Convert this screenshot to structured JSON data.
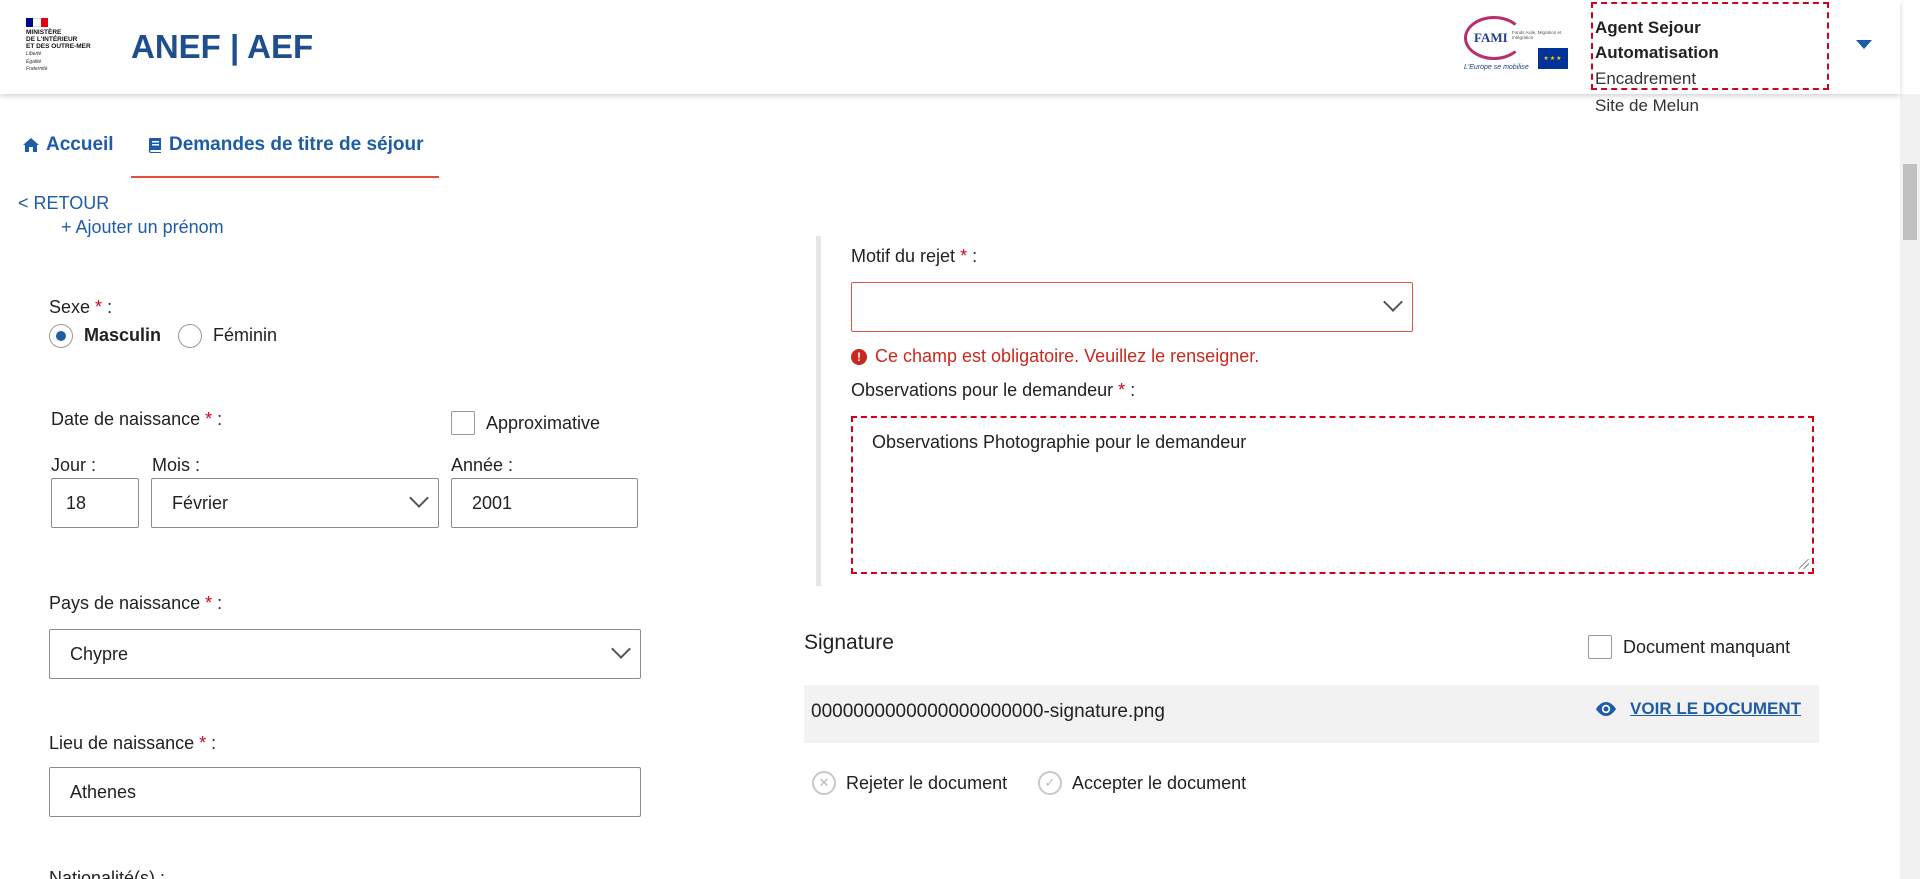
{
  "header": {
    "ministry": [
      "Ministère",
      "de l'intérieur",
      "et des outre-mer"
    ],
    "devise": [
      "Liberté",
      "Égalité",
      "Fraternité"
    ],
    "app_title": "ANEF | AEF",
    "fami": {
      "word": "FAMI",
      "subtitle": "Fonds Asile, Migration et Intégration",
      "slogan": "L'Europe se mobilise"
    },
    "user": {
      "name": "Agent Sejour Automatisation",
      "role": "Encadrement",
      "site": "Site de Melun"
    }
  },
  "nav": {
    "accueil": "Accueil",
    "demandes": "Demandes de titre de séjour",
    "retour": "< RETOUR"
  },
  "form": {
    "add_prenom": "+ Ajouter un prénom",
    "sexe": {
      "label": "Sexe",
      "options": [
        "Masculin",
        "Féminin"
      ],
      "selected": "Masculin"
    },
    "date_naissance": {
      "label": "Date de naissance",
      "approx_label": "Approximative",
      "jour_label": "Jour :",
      "mois_label": "Mois :",
      "annee_label": "Année :",
      "jour": "18",
      "mois": "Février",
      "annee": "2001"
    },
    "pays": {
      "label": "Pays de naissance",
      "value": "Chypre"
    },
    "lieu": {
      "label": "Lieu de naissance",
      "value": "Athenes"
    },
    "nationalite_label": "Nationalité(s) :"
  },
  "review": {
    "motif_label": "Motif du rejet",
    "motif_value": "",
    "error": "Ce champ est obligatoire. Veuillez le renseigner.",
    "observations_label": "Observations pour le demandeur",
    "observations_value": "Observations Photographie pour le demandeur",
    "signature_title": "Signature",
    "document_manquant": "Document manquant",
    "filename": "0000000000000000000000-signature.png",
    "voir": "VOIR LE DOCUMENT",
    "rejeter": "Rejeter le document",
    "accepter": "Accepter le document"
  },
  "colors": {
    "primary": "#1f5ca8",
    "error": "#c8281e",
    "accent_underline": "#e1503c"
  }
}
